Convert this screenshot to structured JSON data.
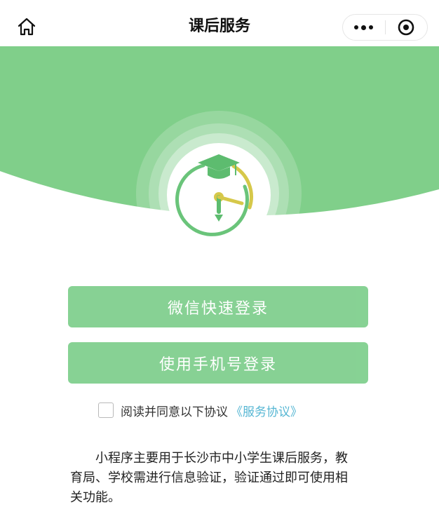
{
  "navbar": {
    "title": "课后服务",
    "home_icon": "home-icon",
    "more_icon": "more-dots-icon",
    "close_icon": "target-close-icon"
  },
  "hero": {
    "logo_icon": "graduation-cap-clock-icon",
    "colors": {
      "banner": "#80cf8a",
      "logo_green": "#6ac47a",
      "logo_yellow": "#d6c84a"
    }
  },
  "buttons": {
    "wechat_login": "微信快速登录",
    "phone_login": "使用手机号登录",
    "color": "#7dce8b"
  },
  "agreement": {
    "text": "阅读并同意以下协议",
    "link": "《服务协议》",
    "checked": false
  },
  "description": {
    "text": "小程序主要用于长沙市中小学生课后服务，教育局、学校需进行信息验证，验证通过即可使用相关功能。"
  }
}
